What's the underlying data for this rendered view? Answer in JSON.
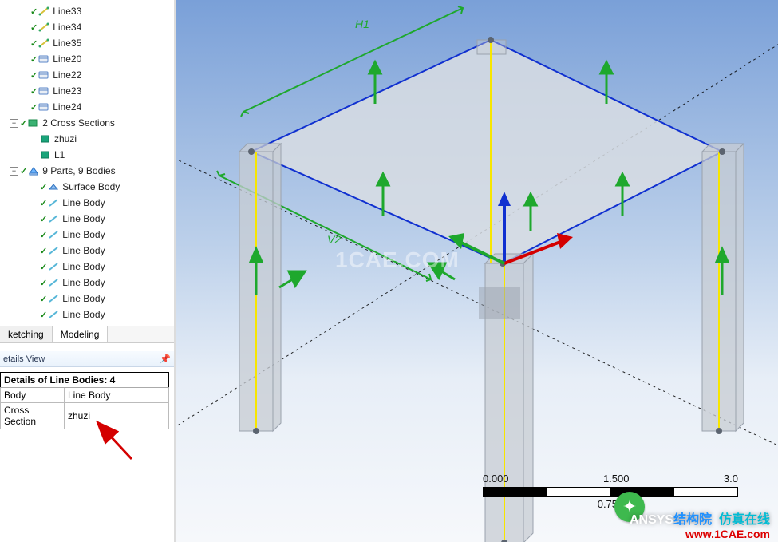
{
  "tree": {
    "top_lines": [
      {
        "name": "Line33",
        "icon": "lineY"
      },
      {
        "name": "Line34",
        "icon": "lineY"
      },
      {
        "name": "Line35",
        "icon": "lineY"
      },
      {
        "name": "Line20",
        "icon": "sheet"
      },
      {
        "name": "Line22",
        "icon": "sheet"
      },
      {
        "name": "Line23",
        "icon": "sheet"
      },
      {
        "name": "Line24",
        "icon": "sheet"
      }
    ],
    "cross_sections": {
      "label": "2 Cross Sections",
      "items": [
        {
          "name": "zhuzi"
        },
        {
          "name": "L1"
        }
      ]
    },
    "parts": {
      "label": "9 Parts, 9 Bodies",
      "items": [
        {
          "name": "Surface Body",
          "icon": "surface"
        },
        {
          "name": "Line Body",
          "icon": "lineC"
        },
        {
          "name": "Line Body",
          "icon": "lineC"
        },
        {
          "name": "Line Body",
          "icon": "lineC"
        },
        {
          "name": "Line Body",
          "icon": "lineC"
        },
        {
          "name": "Line Body",
          "icon": "lineC"
        },
        {
          "name": "Line Body",
          "icon": "lineC"
        },
        {
          "name": "Line Body",
          "icon": "lineC"
        },
        {
          "name": "Line Body",
          "icon": "lineC"
        }
      ]
    }
  },
  "tabs": {
    "sketching": "ketching",
    "modeling": "Modeling"
  },
  "details": {
    "panel_title": "etails View",
    "heading": "Details of Line Bodies: 4",
    "rows": [
      {
        "k": "Body",
        "v": "Line Body"
      },
      {
        "k": "Cross Section",
        "v": "zhuzi"
      }
    ]
  },
  "viewport": {
    "dims": {
      "h1": "H1",
      "v2": "V2"
    },
    "watermark": "1CAE.COM",
    "scale": {
      "start": "0.000",
      "mid": "0.750",
      "half": "1.500",
      "end": "3.0"
    },
    "brand": {
      "line1a": "ANSYS",
      "line1b": "结构院",
      "subline": "仿真在线",
      "url": "www.1CAE.com"
    }
  }
}
